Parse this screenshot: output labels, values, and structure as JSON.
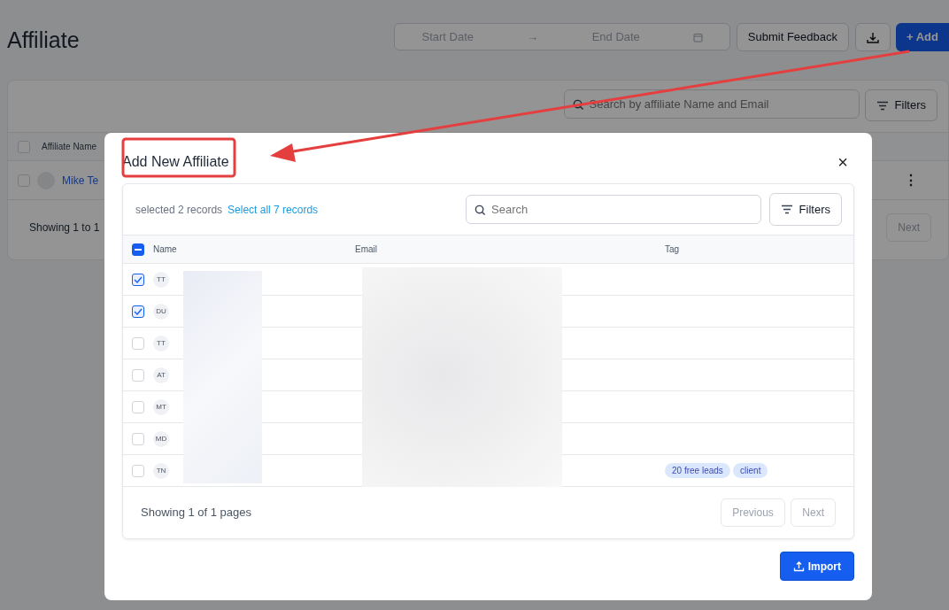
{
  "page": {
    "title": "Affiliate",
    "date_range": {
      "start_placeholder": "Start Date",
      "end_placeholder": "End Date",
      "separator": "→"
    },
    "buttons": [
      {
        "kind": "outline",
        "label": "Submit Feedback"
      },
      {
        "kind": "download"
      },
      {
        "kind": "primary",
        "label": "Add",
        "icon": "+"
      }
    ],
    "search": {
      "placeholder": "Search by affiliate Name and Email"
    },
    "filters_label": "Filters",
    "table": {
      "header_checked": false,
      "columns": [
        "Affiliate Name"
      ],
      "rows": [
        {
          "checked": false,
          "name": "Mike Te",
          "more": "⋮"
        }
      ]
    },
    "footer": {
      "summary": "Showing 1 to 1",
      "next": "Next"
    }
  },
  "modal": {
    "title": "Add New Affiliate",
    "close": "×",
    "selection": {
      "text": "selected 2 records",
      "link": "Select all 7 records"
    },
    "search": {
      "placeholder": "Search"
    },
    "filters_label": "Filters",
    "header_checkbox": {
      "indeterminate": true
    },
    "columns": [
      "Name",
      "Email",
      "Tag"
    ],
    "rows": [
      {
        "initials": "TT",
        "selected": true,
        "tags": []
      },
      {
        "initials": "DU",
        "selected": true,
        "tags": []
      },
      {
        "initials": "TT",
        "selected": false,
        "tags": []
      },
      {
        "initials": "AT",
        "selected": false,
        "tags": []
      },
      {
        "initials": "MT",
        "selected": false,
        "tags": []
      },
      {
        "initials": "MD",
        "selected": false,
        "tags": []
      },
      {
        "initials": "TN",
        "selected": false,
        "tags": [
          "20 free leads",
          "client"
        ]
      }
    ],
    "footer": {
      "summary": "Showing 1 of 1 pages",
      "previous": {
        "label": "Previous",
        "disabled": true
      },
      "next": {
        "label": "Next",
        "disabled": true
      }
    },
    "import_label": "Import"
  },
  "callout": {
    "highlight_title": true,
    "arrow": true
  }
}
